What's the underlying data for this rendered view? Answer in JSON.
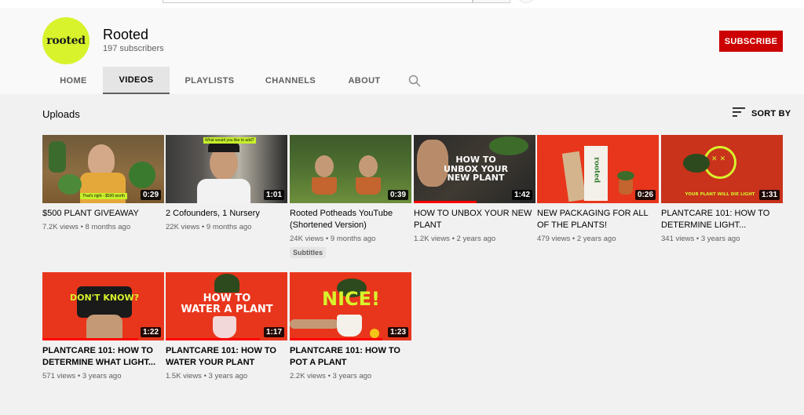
{
  "channel": {
    "avatar_text": "rooted",
    "name": "Rooted",
    "subscribers": "197 subscribers",
    "subscribe_label": "SUBSCRIBE"
  },
  "tabs": [
    {
      "label": "HOME"
    },
    {
      "label": "VIDEOS"
    },
    {
      "label": "PLAYLISTS"
    },
    {
      "label": "CHANNELS"
    },
    {
      "label": "ABOUT"
    }
  ],
  "uploads": {
    "title": "Uploads",
    "sort_label": "SORT BY"
  },
  "videos": [
    {
      "title": "$500 PLANT GIVEAWAY",
      "meta": "7.2K views • 8 months ago",
      "duration": "0:29",
      "thumb_caption": "That's right - $500 worth"
    },
    {
      "title": "2 Cofounders, 1 Nursery",
      "meta": "22K views • 9 months ago",
      "duration": "1:01",
      "thumb_caption": "What would you like to add?"
    },
    {
      "title": "Rooted Potheads YouTube (Shortened Version)",
      "meta": "24K views • 9 months ago",
      "duration": "0:39",
      "badge": "Subtitles"
    },
    {
      "title": "HOW TO UNBOX YOUR NEW PLANT",
      "meta": "1.2K views • 2 years ago",
      "duration": "1:42",
      "thumb_text": "HOW TO\nUNBOX YOUR\nNEW PLANT"
    },
    {
      "title": "NEW PACKAGING FOR ALL OF THE PLANTS!",
      "meta": "479 views • 2 years ago",
      "duration": "0:26",
      "thumb_text": "rooted"
    },
    {
      "title": "PLANTCARE 101: HOW TO DETERMINE LIGHT...",
      "meta": "341 views • 3 years ago",
      "duration": "1:31",
      "thumb_text": "YOUR PLANT WILL DIE LIGHT"
    },
    {
      "title": "PLANTCARE 101: HOW TO DETERMINE WHAT LIGHT...",
      "meta": "571 views • 3 years ago",
      "duration": "1:22",
      "thumb_text": "DON'T KNOW?"
    },
    {
      "title": "PLANTCARE 101: HOW TO WATER YOUR PLANT",
      "meta": "1.5K views • 3 years ago",
      "duration": "1:17",
      "thumb_text": "HOW TO\nWATER A PLANT"
    },
    {
      "title": "PLANTCARE 101: HOW TO POT A PLANT",
      "meta": "2.2K views • 3 years ago",
      "duration": "1:23",
      "thumb_text": "NICE!"
    }
  ],
  "colors": {
    "brand_green": "#d8f32c",
    "subscribe_red": "#cc0000",
    "thumb_red": "#e8361c"
  }
}
